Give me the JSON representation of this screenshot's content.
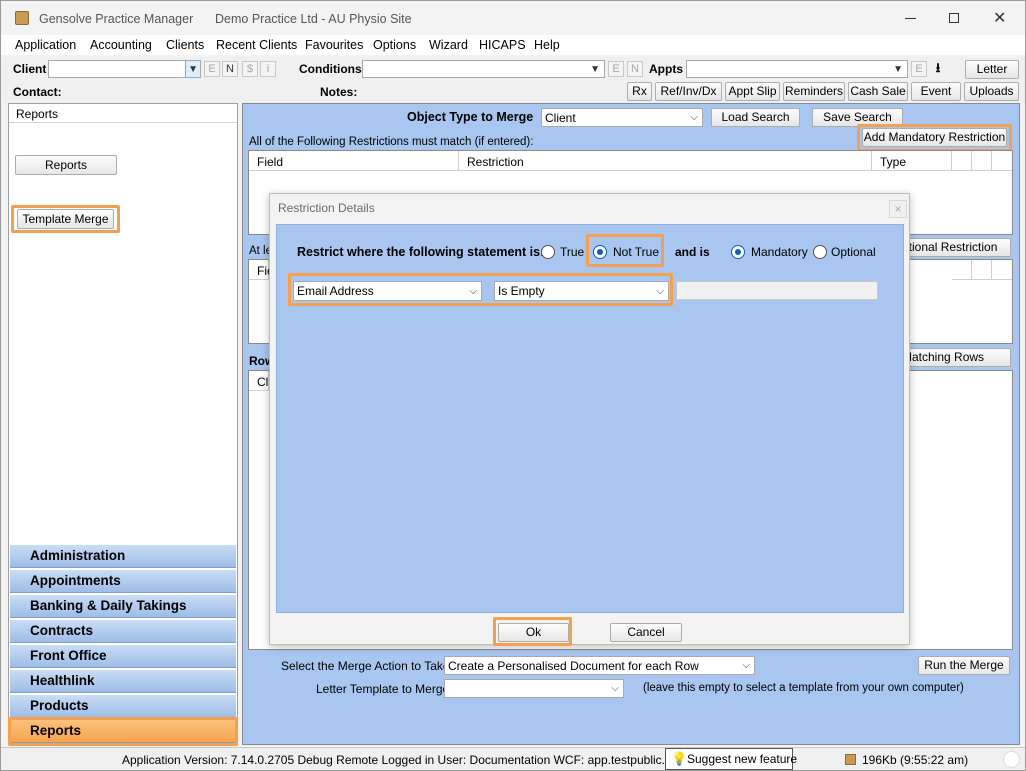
{
  "titlebar": {
    "app_name": "Gensolve Practice Manager",
    "practice": "Demo Practice Ltd - AU Physio Site"
  },
  "menu": [
    "Application",
    "Accounting",
    "Clients",
    "Recent Clients",
    "Favourites",
    "Options",
    "Wizard",
    "HICAPS",
    "Help"
  ],
  "toolbar": {
    "client_label": "Client",
    "client_letters": [
      "E",
      "N",
      "$",
      "i"
    ],
    "conditions_label": "Conditions",
    "conditions_letters": [
      "E",
      "N"
    ],
    "appts_label": "Appts",
    "appts_letter": "E",
    "letter_button": "Letter",
    "contact_label": "Contact:",
    "notes_label": "Notes:",
    "buttons": [
      "Rx",
      "Ref/Inv/Dx",
      "Appt Slip",
      "Reminders",
      "Cash Sale",
      "Event",
      "Uploads"
    ]
  },
  "sidebar": {
    "header": "Reports",
    "reports_button": "Reports",
    "template_merge_button": "Template Merge",
    "nav": [
      "Administration",
      "Appointments",
      "Banking & Daily Takings",
      "Contracts",
      "Front Office",
      "Healthlink",
      "Products",
      "Reports"
    ]
  },
  "main": {
    "object_type_label": "Object Type to Merge",
    "object_type_value": "Client",
    "load_search": "Load Search",
    "save_search": "Save Search",
    "add_mandatory": "Add Mandatory Restriction",
    "all_following": "All of the Following Restrictions must match (if entered):",
    "cols": [
      "Field",
      "Restriction",
      "Type"
    ],
    "at_least_partial": "At le",
    "field_partial": "Fie",
    "optional_button_partial": "ptional Restriction",
    "rows_label_partial": "Row",
    "client_partial": "Cli",
    "matching_rows_partial": "Matching Rows",
    "merge_action_label": "Select the Merge Action to Take",
    "merge_action_value": "Create a Personalised Document for each Row",
    "run_merge": "Run the Merge",
    "letter_template_label": "Letter Template to Merge",
    "letter_template_hint": "(leave this empty to select a template from your own computer)"
  },
  "dialog": {
    "title": "Restriction Details",
    "close": "×",
    "statement_label": "Restrict where the following statement is:",
    "true_label": "True",
    "not_true_label": "Not True",
    "and_is_label": "and is",
    "mandatory_label": "Mandatory",
    "optional_label": "Optional",
    "field_value": "Email Address",
    "condition_value": "Is Empty",
    "ok": "Ok",
    "cancel": "Cancel"
  },
  "statusbar": {
    "version": "Application Version: 7.14.0.2705 Debug Remote  Logged in User: Documentation WCF: app.testpublic.gensolve.co",
    "suggest": "Suggest new feature",
    "memory": "196Kb  (9:55:22 am)"
  },
  "colors": {
    "highlight": "#f4a04f",
    "panel_blue": "#a8c6ef",
    "nav_blue": "#b3cdee"
  }
}
